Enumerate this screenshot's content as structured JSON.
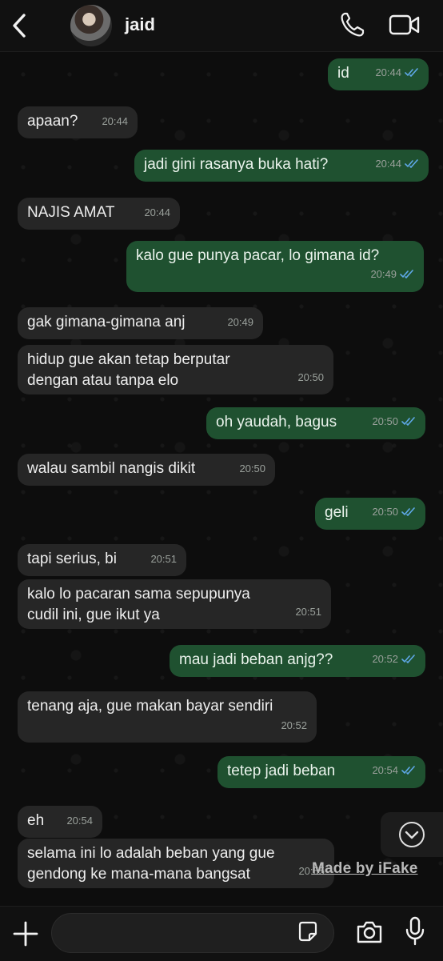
{
  "header": {
    "contact_name": "jaid",
    "icons": [
      "back-chevron-icon",
      "phone-icon",
      "video-call-icon"
    ]
  },
  "messages": [
    {
      "dir": "out",
      "text": "id",
      "time": "20:44",
      "ticks": "read"
    },
    {
      "dir": "in",
      "text": "apaan?",
      "time": "20:44"
    },
    {
      "dir": "out",
      "text": "jadi gini rasanya buka hati?",
      "time": "20:44",
      "ticks": "read"
    },
    {
      "dir": "in",
      "text": "NAJIS AMAT",
      "time": "20:44"
    },
    {
      "dir": "out",
      "text": "kalo gue punya pacar, lo gimana id?",
      "time": "20:49",
      "ticks": "read"
    },
    {
      "dir": "in",
      "text": "gak gimana-gimana anj",
      "time": "20:49"
    },
    {
      "dir": "in",
      "text": "hidup gue akan tetap berputar dengan atau tanpa elo",
      "time": "20:50"
    },
    {
      "dir": "out",
      "text": "oh yaudah, bagus",
      "time": "20:50",
      "ticks": "read"
    },
    {
      "dir": "in",
      "text": "walau sambil nangis dikit",
      "time": "20:50"
    },
    {
      "dir": "out",
      "text": "geli",
      "time": "20:50",
      "ticks": "read"
    },
    {
      "dir": "in",
      "text": "tapi serius, bi",
      "time": "20:51"
    },
    {
      "dir": "in",
      "text": "kalo lo pacaran sama sepupunya cudil ini, gue ikut ya",
      "time": "20:51"
    },
    {
      "dir": "out",
      "text": "mau jadi beban anjg??",
      "time": "20:52",
      "ticks": "read"
    },
    {
      "dir": "in",
      "text": "tenang aja, gue makan bayar sendiri",
      "time": "20:52"
    },
    {
      "dir": "out",
      "text": "tetep jadi beban",
      "time": "20:54",
      "ticks": "read"
    },
    {
      "dir": "in",
      "text": "eh",
      "time": "20:54"
    },
    {
      "dir": "in",
      "text": "selama ini lo adalah beban yang gue gendong ke mana-mana bangsat",
      "time": "20:55"
    }
  ],
  "watermark": "Made by iFake",
  "colors": {
    "incoming_bubble": "#262626",
    "outgoing_bubble": "#1f5130",
    "read_ticks": "#5fa8e8",
    "background": "#0d0d0d"
  },
  "bottom_bar": {
    "icons": [
      "plus-icon",
      "sticker-icon",
      "camera-icon",
      "microphone-icon"
    ]
  }
}
